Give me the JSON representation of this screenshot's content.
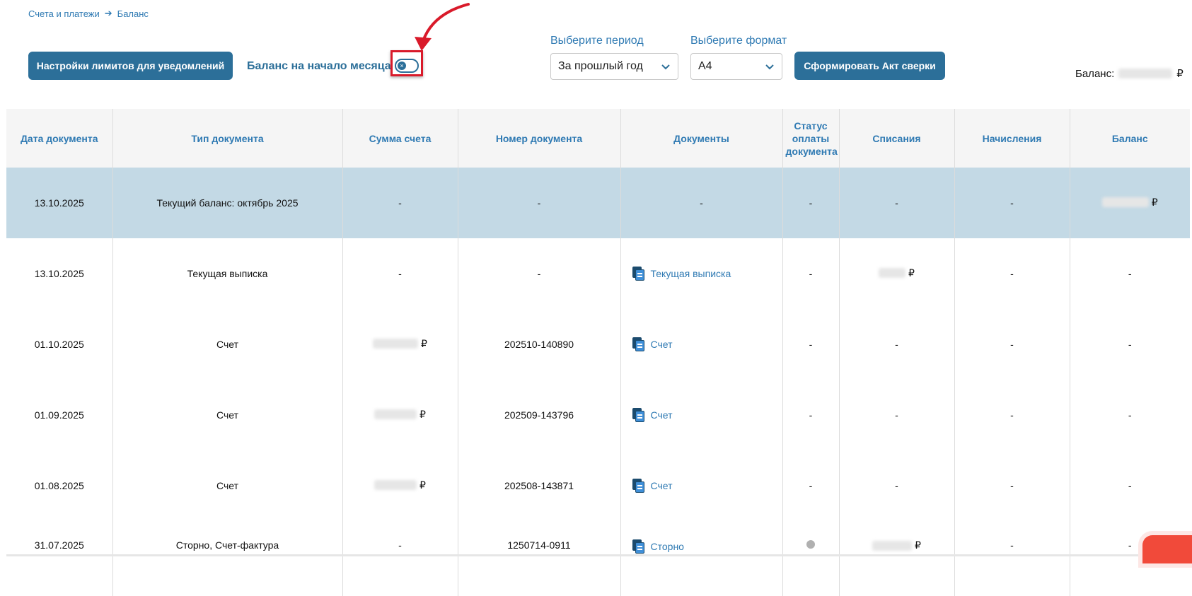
{
  "breadcrumb": {
    "parent": "Счета и платежи",
    "current": "Баланс"
  },
  "toolbar": {
    "limits_button": "Настройки лимитов для уведомлений",
    "toggle_label": "Баланс на начало месяца",
    "toggle_state": "off",
    "period_label": "Выберите период",
    "period_value": "За прошлый год",
    "format_label": "Выберите формат",
    "format_value": "A4",
    "act_button": "Сформировать Акт сверки",
    "balance_label": "Баланс:",
    "currency": "₽"
  },
  "table": {
    "headers": [
      "Дата документа",
      "Тип документа",
      "Сумма счета",
      "Номер документа",
      "Документы",
      "Статус оплаты документа",
      "Списания",
      "Начисления",
      "Баланс"
    ],
    "rows": [
      {
        "date": "13.10.2025",
        "type": "Текущий баланс: октябрь 2025",
        "sum": "-",
        "number": "-",
        "document": "-",
        "status": "-",
        "debit": "-",
        "credit": "-",
        "balance": "₽"
      },
      {
        "date": "13.10.2025",
        "type": "Текущая выписка",
        "sum": "-",
        "number": "-",
        "document": "Текущая выписка",
        "status": "-",
        "debit": "₽",
        "credit": "-",
        "balance": "-"
      },
      {
        "date": "01.10.2025",
        "type": "Счет",
        "sum": "₽",
        "number": "202510-140890",
        "document": "Счет",
        "status": "-",
        "debit": "-",
        "credit": "-",
        "balance": "-"
      },
      {
        "date": "01.09.2025",
        "type": "Счет",
        "sum": "₽",
        "number": "202509-143796",
        "document": "Счет",
        "status": "-",
        "debit": "-",
        "credit": "-",
        "balance": "-"
      },
      {
        "date": "01.08.2025",
        "type": "Счет",
        "sum": "₽",
        "number": "202508-143871",
        "document": "Счет",
        "status": "-",
        "debit": "-",
        "credit": "-",
        "balance": "-"
      },
      {
        "date": "31.07.2025",
        "type": "Сторно, Счет-фактура",
        "sum": "-",
        "number": "1250714-0911",
        "document": "Сторно",
        "status": "",
        "debit": "₽",
        "credit": "-",
        "balance": "-"
      }
    ]
  },
  "colors": {
    "accent": "#2c6f99",
    "link": "#2f7ab3",
    "highlight_row": "#c3d9e5",
    "annotation_red": "#d91a2a"
  }
}
